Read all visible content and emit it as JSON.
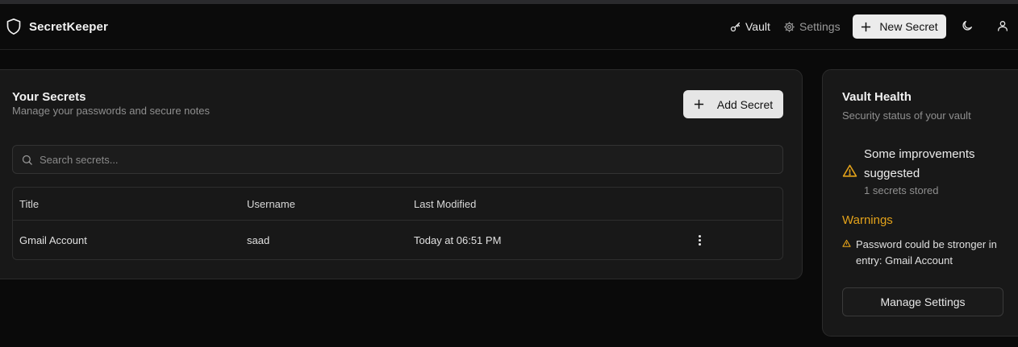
{
  "app": {
    "name": "SecretKeeper"
  },
  "nav": {
    "vault_label": "Vault",
    "settings_label": "Settings",
    "new_secret_label": "New Secret"
  },
  "icons": {
    "brand": "shield-icon",
    "vault": "key-icon",
    "settings": "gear-icon",
    "new": "plus-icon",
    "theme": "moon-icon",
    "user": "user-icon",
    "search": "search-icon",
    "more": "more-vertical-icon",
    "warning": "warning-triangle-icon"
  },
  "colors": {
    "accent_warning": "#e3a21a",
    "button_light": "#ececec"
  },
  "secrets": {
    "title": "Your Secrets",
    "subtitle": "Manage your passwords and secure notes",
    "add_label": "Add Secret",
    "search_placeholder": "Search secrets...",
    "columns": [
      "Title",
      "Username",
      "Last Modified"
    ],
    "rows": [
      {
        "title": "Gmail Account",
        "username": "saad",
        "modified": "Today at 06:51 PM"
      }
    ]
  },
  "health": {
    "title": "Vault Health",
    "subtitle": "Security status of your vault",
    "status": "Some improvements suggested",
    "count": "1 secrets stored",
    "warnings_heading": "Warnings",
    "warnings": [
      "Password could be stronger in entry: Gmail Account"
    ],
    "manage_label": "Manage Settings"
  }
}
